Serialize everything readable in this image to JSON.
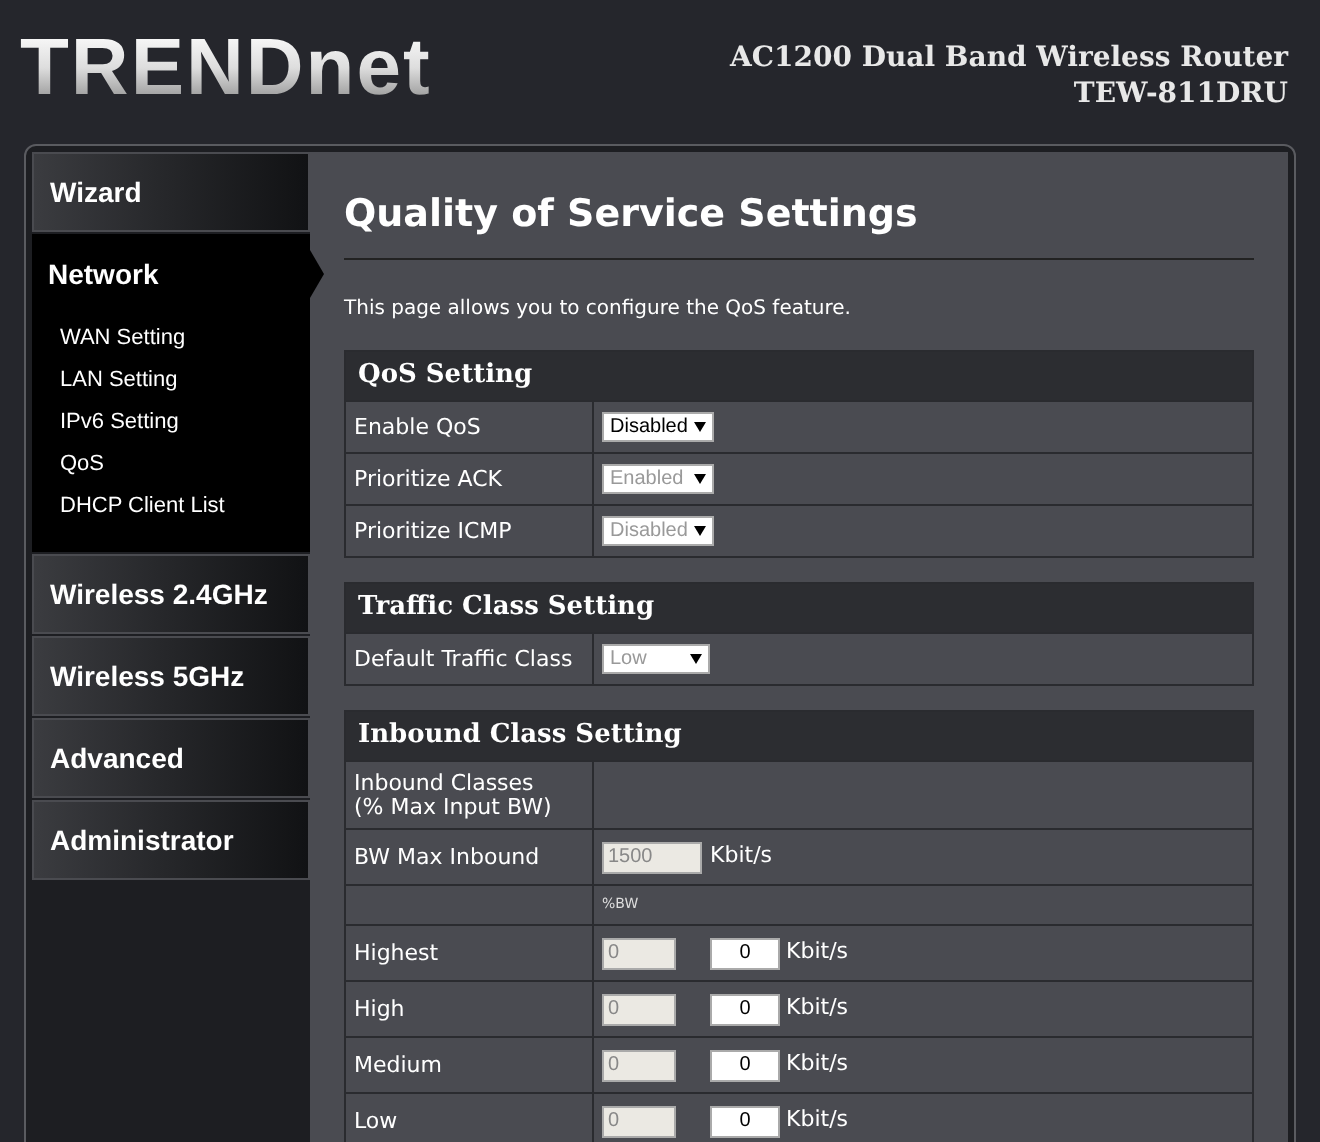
{
  "header": {
    "logo": "TRENDnet",
    "product": "AC1200 Dual Band Wireless Router",
    "model": "TEW-811DRU"
  },
  "sidebar": {
    "items": [
      {
        "label": "Wizard",
        "expanded": false
      },
      {
        "label": "Network",
        "expanded": true,
        "children": [
          {
            "label": "WAN Setting"
          },
          {
            "label": "LAN Setting"
          },
          {
            "label": "IPv6 Setting"
          },
          {
            "label": "QoS"
          },
          {
            "label": "DHCP Client List"
          }
        ]
      },
      {
        "label": "Wireless 2.4GHz",
        "expanded": false
      },
      {
        "label": "Wireless 5GHz",
        "expanded": false
      },
      {
        "label": "Advanced",
        "expanded": false
      },
      {
        "label": "Administrator",
        "expanded": false
      }
    ]
  },
  "page": {
    "title": "Quality of Service Settings",
    "description": "This page allows you to configure the QoS feature."
  },
  "sections": [
    {
      "title": "QoS Setting",
      "rows": [
        {
          "kind": "select",
          "label": "Enable QoS",
          "value": "Disabled",
          "disabled": false
        },
        {
          "kind": "select",
          "label": "Prioritize ACK",
          "value": "Enabled",
          "disabled": true
        },
        {
          "kind": "select",
          "label": "Prioritize ICMP",
          "value": "Disabled",
          "disabled": true
        }
      ]
    },
    {
      "title": "Traffic Class Setting",
      "rows": [
        {
          "kind": "select",
          "label": "Default Traffic Class",
          "value": "Low",
          "disabled": true
        }
      ]
    },
    {
      "title": "Inbound Class Setting",
      "rows": [
        {
          "kind": "label",
          "label": "Inbound Classes\n(% Max Input BW)"
        },
        {
          "kind": "bandwidth",
          "label": "BW Max Inbound",
          "value": "1500",
          "disabled": true,
          "unit": "Kbit/s"
        },
        {
          "kind": "caption",
          "caption": "%BW"
        },
        {
          "kind": "class",
          "label": "Highest",
          "percent": "0",
          "percent_disabled": true,
          "rate": "0",
          "unit": "Kbit/s"
        },
        {
          "kind": "class",
          "label": "High",
          "percent": "0",
          "percent_disabled": true,
          "rate": "0",
          "unit": "Kbit/s"
        },
        {
          "kind": "class",
          "label": "Medium",
          "percent": "0",
          "percent_disabled": true,
          "rate": "0",
          "unit": "Kbit/s"
        },
        {
          "kind": "class",
          "label": "Low",
          "percent": "0",
          "percent_disabled": true,
          "rate": "0",
          "unit": "Kbit/s"
        }
      ]
    }
  ]
}
